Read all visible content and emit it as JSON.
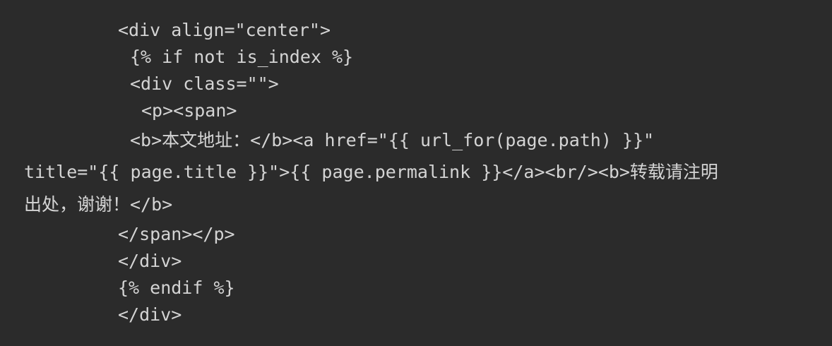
{
  "editor": {
    "background": "#2b2b2b",
    "text_color": "#d4d4d4",
    "lines": [
      "<div align=\"center\">",
      "{% if not is_index %}",
      "<div class=\"\">",
      "<p><span>",
      "<b>本文地址：</b><a href=\"{{ url_for(page.path) }}\"",
      "title=\"{{ page.title }}\">{{ page.permalink }}</a><br/><b>转载请注明",
      "出处，谢谢！</b>",
      "</span></p>",
      "</div>",
      "{% endif %}",
      "</div>"
    ]
  }
}
